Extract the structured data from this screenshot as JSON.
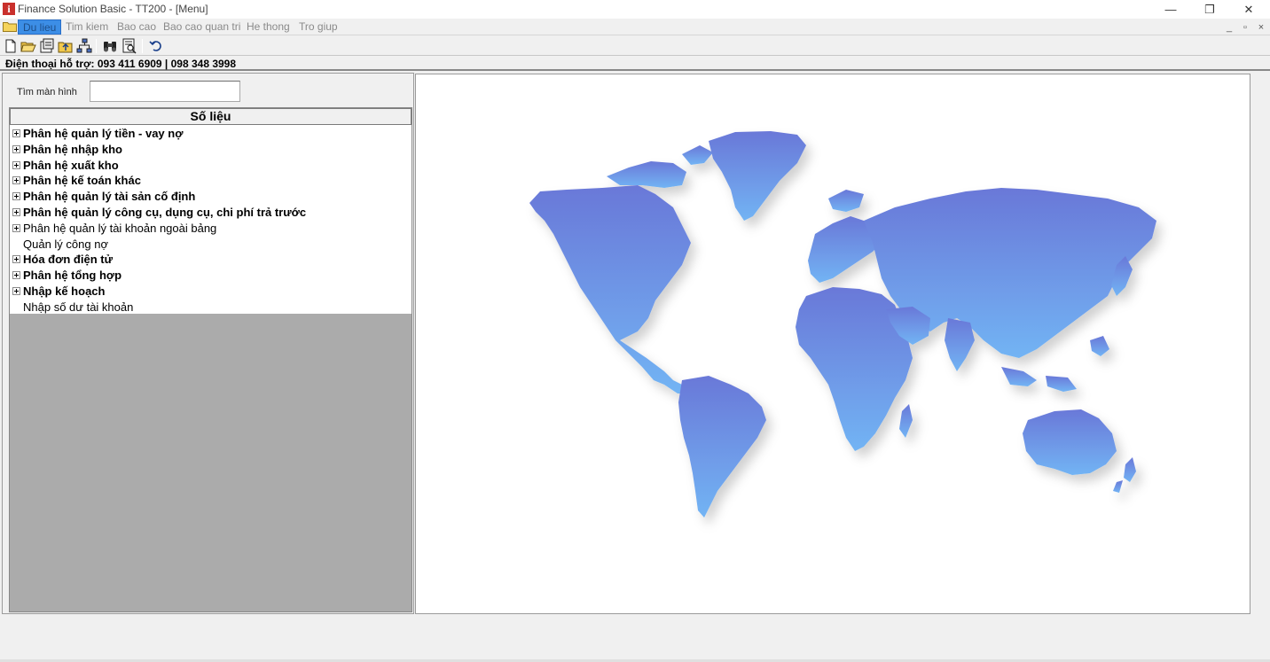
{
  "window": {
    "title": "Finance Solution Basic - TT200 - [Menu]",
    "app_icon_letter": "i",
    "minimize": "—",
    "restore": "❐",
    "close": "✕"
  },
  "menubar": {
    "items": [
      {
        "label": "Du lieu",
        "active": true
      },
      {
        "label": "Tim kiem",
        "active": false
      },
      {
        "label": "Bao cao",
        "active": false
      },
      {
        "label": "Bao cao quan tri",
        "active": false
      },
      {
        "label": "He thong",
        "active": false
      },
      {
        "label": "Tro giup",
        "active": false
      }
    ],
    "mdi_minimize": "_",
    "mdi_restore": "▫",
    "mdi_close": "×"
  },
  "toolbar": {
    "icons": [
      "new-file-icon",
      "open-folder-icon",
      "properties-icon",
      "folder-up-icon",
      "network-tree-icon",
      "binoculars-icon",
      "preview-icon",
      "undo-icon"
    ]
  },
  "support": {
    "phone_text": "Điện thoại hỗ trợ: 093 411 6909 | 098 348 3998"
  },
  "search": {
    "label": "Tìm màn hình",
    "value": ""
  },
  "tree": {
    "header": "Số liệu",
    "items": [
      {
        "label": "Phân hệ quản lý tiền -  vay nợ",
        "bold": true,
        "expandable": true
      },
      {
        "label": "Phân hệ nhập kho",
        "bold": true,
        "expandable": true
      },
      {
        "label": "Phân hệ xuất kho",
        "bold": true,
        "expandable": true
      },
      {
        "label": "Phân hệ kế toán khác",
        "bold": true,
        "expandable": true
      },
      {
        "label": "Phân hệ quản lý tài sản cố định",
        "bold": true,
        "expandable": true
      },
      {
        "label": "Phân hệ quản lý công cụ, dụng cụ, chi phí trả trước",
        "bold": true,
        "expandable": true
      },
      {
        "label": "Phân hệ quản lý tài khoản ngoài bảng",
        "bold": false,
        "expandable": true
      },
      {
        "label": "Quản lý công nợ",
        "bold": false,
        "expandable": false
      },
      {
        "label": "Hóa đơn điện tử",
        "bold": true,
        "expandable": true
      },
      {
        "label": "Phân hệ  tổng hợp",
        "bold": true,
        "expandable": true
      },
      {
        "label": "Nhập kế hoạch",
        "bold": true,
        "expandable": true
      },
      {
        "label": "Nhập số dư tài khoản",
        "bold": false,
        "expandable": false
      }
    ]
  },
  "colors": {
    "accent": "#3c8ee6",
    "map_top": "#6a78d8",
    "map_bottom": "#72b4f4",
    "tree_background": "#ababab"
  }
}
